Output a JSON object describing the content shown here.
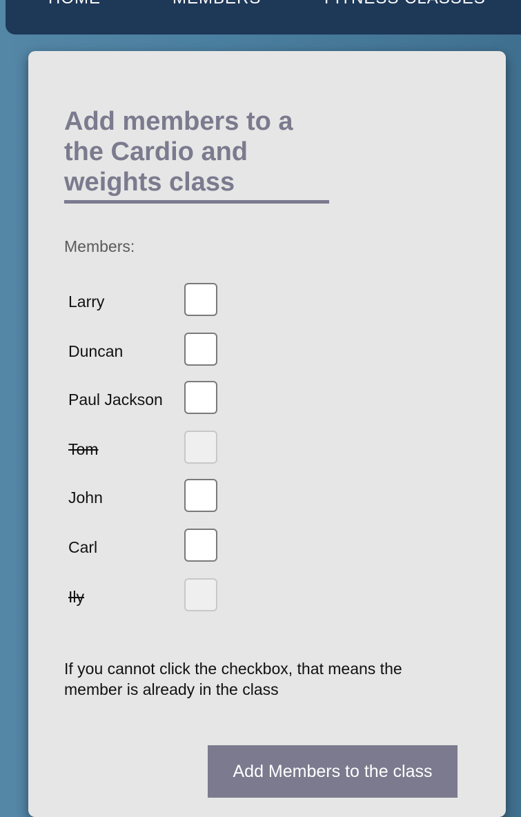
{
  "nav": {
    "items": [
      {
        "label": "HOME"
      },
      {
        "label": "MEMBERS"
      },
      {
        "label": "FITNESS CLASSES"
      }
    ]
  },
  "form": {
    "title": "Add members to a the Cardio and weights class",
    "members_label": "Members:",
    "members": [
      {
        "name": "Larry",
        "checked": false,
        "disabled": false
      },
      {
        "name": "Duncan",
        "checked": false,
        "disabled": false
      },
      {
        "name": "Paul Jackson",
        "checked": false,
        "disabled": false
      },
      {
        "name": "Tom",
        "checked": false,
        "disabled": true
      },
      {
        "name": "John",
        "checked": false,
        "disabled": false
      },
      {
        "name": "Carl",
        "checked": false,
        "disabled": false
      },
      {
        "name": "Ily",
        "checked": false,
        "disabled": true
      }
    ],
    "note": "If you cannot click the checkbox, that means the member is already in the class",
    "submit_label": "Add Members to the class"
  },
  "colors": {
    "nav_background": "#1e3858",
    "page_background": "#4b7fa0",
    "card_background": "#e6e6e6",
    "accent": "#7b7a8e"
  }
}
